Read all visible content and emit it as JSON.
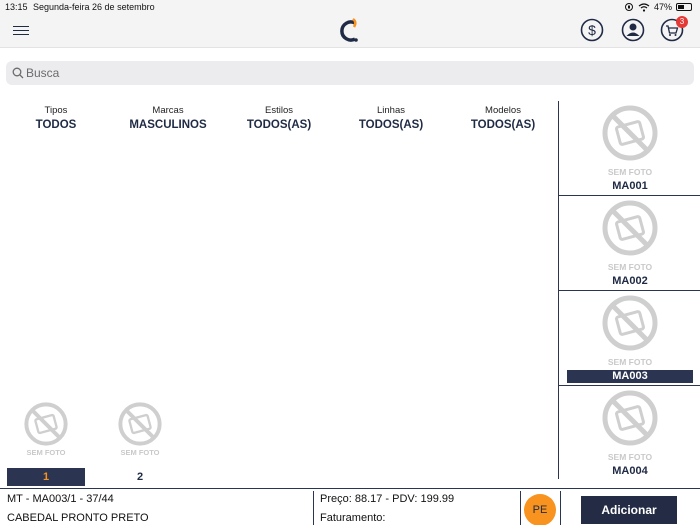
{
  "status_bar": {
    "time": "13:15",
    "date": "Segunda-feira 26 de setembro",
    "battery": "47%",
    "battery_level": 0.47
  },
  "header": {
    "menu_icon": "hamburger-menu-icon",
    "logo_icon": "c-logo-icon",
    "price_icon": "dollar-icon",
    "user_icon": "user-icon",
    "cart_icon": "cart-icon",
    "cart_count": "3",
    "accent_color": "#f7931e",
    "primary_color": "#2b3552"
  },
  "search": {
    "placeholder": "Busca"
  },
  "filters": [
    {
      "label": "Tipos",
      "value": "TODOS"
    },
    {
      "label": "Marcas",
      "value": "MASCULINOS"
    },
    {
      "label": "Estilos",
      "value": "TODOS(AS)"
    },
    {
      "label": "Linhas",
      "value": "TODOS(AS)"
    },
    {
      "label": "Modelos",
      "value": "TODOS(AS)"
    }
  ],
  "products": [
    {
      "no_photo": "SEM FOTO",
      "code": "MA001",
      "selected": false
    },
    {
      "no_photo": "SEM FOTO",
      "code": "MA002",
      "selected": false
    },
    {
      "no_photo": "SEM FOTO",
      "code": "MA003",
      "selected": true
    },
    {
      "no_photo": "SEM FOTO",
      "code": "MA004",
      "selected": false
    }
  ],
  "pages": [
    {
      "no_photo": "SEM FOTO",
      "label": "1",
      "active": true
    },
    {
      "no_photo": "SEM FOTO",
      "label": "2",
      "active": false
    }
  ],
  "footer": {
    "item_ref": "MT - MA003/1 - 37/44",
    "item_desc": "CABEDAL PRONTO PRETO",
    "price": "Preço: 88.17 - PDV: 199.99",
    "billing": "Faturamento:",
    "pe_label": "PE",
    "add_label": "Adicionar"
  }
}
